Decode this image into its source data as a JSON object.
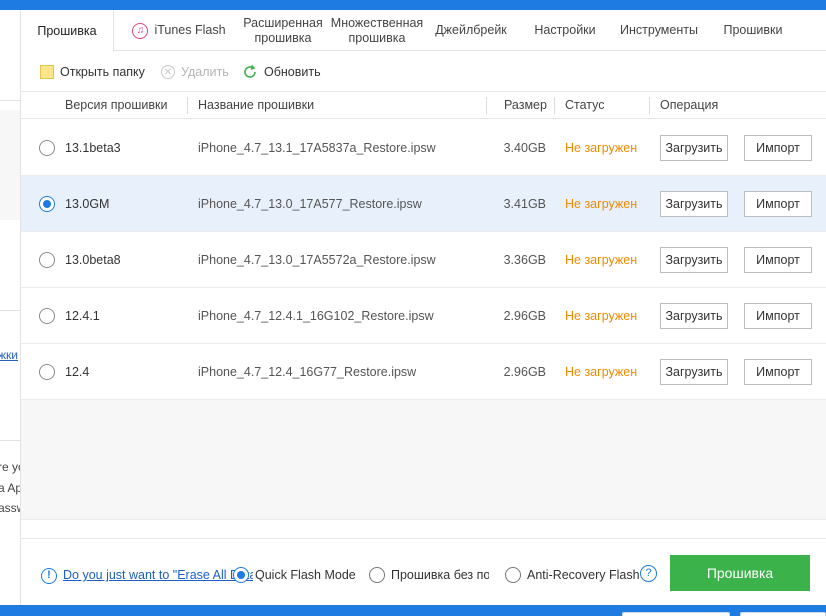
{
  "tabs": [
    {
      "label": "Прошивка"
    },
    {
      "label": "iTunes Flash"
    },
    {
      "label": "Расширенная прошивка"
    },
    {
      "label": "Множественная прошивка"
    },
    {
      "label": "Джейлбрейк"
    },
    {
      "label": "Настройки"
    },
    {
      "label": "Инструменты"
    },
    {
      "label": "Прошивки"
    }
  ],
  "toolbar": {
    "open_folder": "Открыть папку",
    "delete": "Удалить",
    "refresh": "Обновить"
  },
  "table": {
    "columns": [
      "Версия прошивки",
      "Название прошивки",
      "Размер",
      "Статус",
      "Операция"
    ],
    "rows": [
      {
        "version": "13.1beta3",
        "name": "iPhone_4.7_13.1_17A5837a_Restore.ipsw",
        "size": "3.40GB",
        "status": "Не загружен",
        "selected": false
      },
      {
        "version": "13.0GM",
        "name": "iPhone_4.7_13.0_17A577_Restore.ipsw",
        "size": "3.41GB",
        "status": "Не загружен",
        "selected": true
      },
      {
        "version": "13.0beta8",
        "name": "iPhone_4.7_13.0_17A5572a_Restore.ipsw",
        "size": "3.36GB",
        "status": "Не загружен",
        "selected": false
      },
      {
        "version": "12.4.1",
        "name": "iPhone_4.7_12.4.1_16G102_Restore.ipsw",
        "size": "2.96GB",
        "status": "Не загружен",
        "selected": false
      },
      {
        "version": "12.4",
        "name": "iPhone_4.7_12.4_16G77_Restore.ipsw",
        "size": "2.96GB",
        "status": "Не загружен",
        "selected": false
      }
    ],
    "download_label": "Загрузить",
    "import_label": "Импорт"
  },
  "footer": {
    "erase_link": "Do you just want to \"Erase All Data\"",
    "mode_quick": "Quick Flash Mode",
    "mode_nodata": "Прошивка без потери данных",
    "mode_anti": "Anti-Recovery Flash",
    "help": "?",
    "info": "!",
    "flash_button": "Прошивка"
  },
  "left_fragments": {
    "link": "жки",
    "line1": "re yo",
    "line2": "a Ap",
    "line3": "assw"
  },
  "colors": {
    "accent": "#1d7be2",
    "status": "#f08a00",
    "primary_button": "#3cb34a",
    "selected_row": "#e8f1fb"
  }
}
